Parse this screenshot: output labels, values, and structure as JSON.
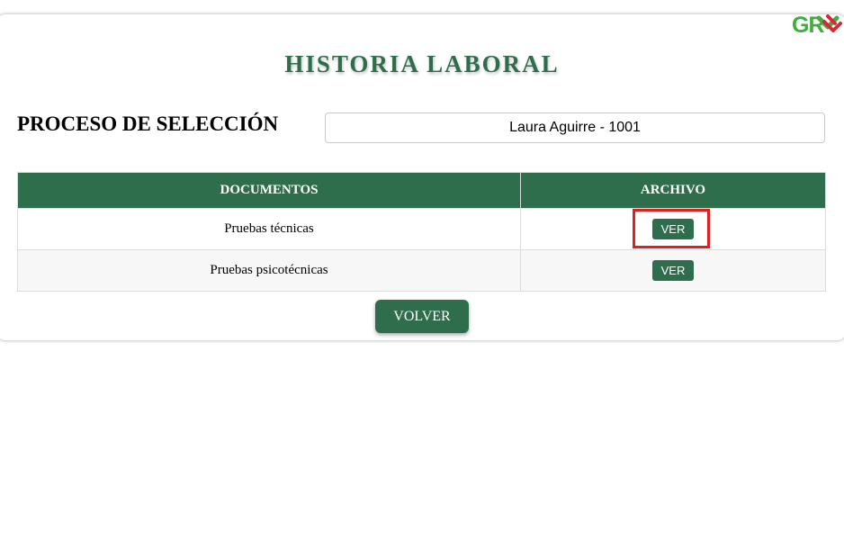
{
  "logo": {
    "text": "GR",
    "icon": "logo-icon",
    "colors": {
      "green": "#3fae3f",
      "red": "#d62a36"
    }
  },
  "page": {
    "title": "HISTORIA LABORAL"
  },
  "selection": {
    "label": "PROCESO DE SELECCIÓN",
    "candidate": "Laura Aguirre - 1001"
  },
  "table": {
    "headers": [
      "DOCUMENTOS",
      "ARCHIVO"
    ],
    "rows": [
      {
        "document": "Pruebas técnicas",
        "action": "VER",
        "highlighted": true
      },
      {
        "document": "Pruebas psicotécnicas",
        "action": "VER",
        "highlighted": false
      }
    ]
  },
  "actions": {
    "back_label": "VOLVER"
  },
  "theme": {
    "primary": "#2e6e4c",
    "highlight": "#e02020"
  }
}
